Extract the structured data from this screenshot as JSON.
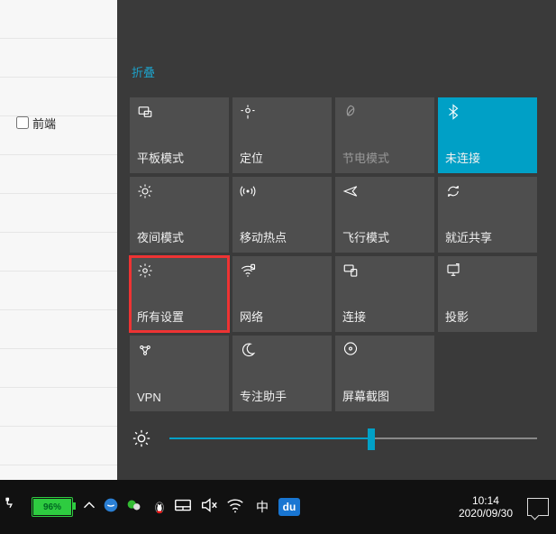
{
  "background": {
    "checkbox_label": "前端"
  },
  "panel": {
    "collapse_label": "折叠",
    "tiles": [
      {
        "id": "tablet",
        "label": "平板模式",
        "icon": "tablet-icon",
        "state": "off"
      },
      {
        "id": "location",
        "label": "定位",
        "icon": "location-icon",
        "state": "off"
      },
      {
        "id": "battery-saver",
        "label": "节电模式",
        "icon": "leaf-icon",
        "state": "dim"
      },
      {
        "id": "bluetooth",
        "label": "未连接",
        "icon": "bluetooth-icon",
        "state": "on"
      },
      {
        "id": "night-light",
        "label": "夜间模式",
        "icon": "sun-icon",
        "state": "off"
      },
      {
        "id": "hotspot",
        "label": "移动热点",
        "icon": "hotspot-icon",
        "state": "off"
      },
      {
        "id": "airplane",
        "label": "飞行模式",
        "icon": "airplane-icon",
        "state": "off"
      },
      {
        "id": "nearby-share",
        "label": "就近共享",
        "icon": "share-icon",
        "state": "off"
      },
      {
        "id": "all-settings",
        "label": "所有设置",
        "icon": "gear-icon",
        "state": "off",
        "highlight": true
      },
      {
        "id": "network",
        "label": "网络",
        "icon": "wifi-icon",
        "state": "off"
      },
      {
        "id": "connect",
        "label": "连接",
        "icon": "connect-icon",
        "state": "off"
      },
      {
        "id": "project",
        "label": "投影",
        "icon": "project-icon",
        "state": "off"
      },
      {
        "id": "vpn",
        "label": "VPN",
        "icon": "vpn-icon",
        "state": "off"
      },
      {
        "id": "focus-assist",
        "label": "专注助手",
        "icon": "moon-icon",
        "state": "off"
      },
      {
        "id": "screen-snip",
        "label": "屏幕截图",
        "icon": "snip-icon",
        "state": "off"
      }
    ],
    "brightness_percent": 55
  },
  "taskbar": {
    "battery_percent": "96%",
    "ime": "中",
    "du_label": "du",
    "time": "10:14",
    "date": "2020/09/30"
  },
  "colors": {
    "accent": "#00a0c6",
    "highlight": "#e33",
    "battery": "#2ecc40"
  }
}
